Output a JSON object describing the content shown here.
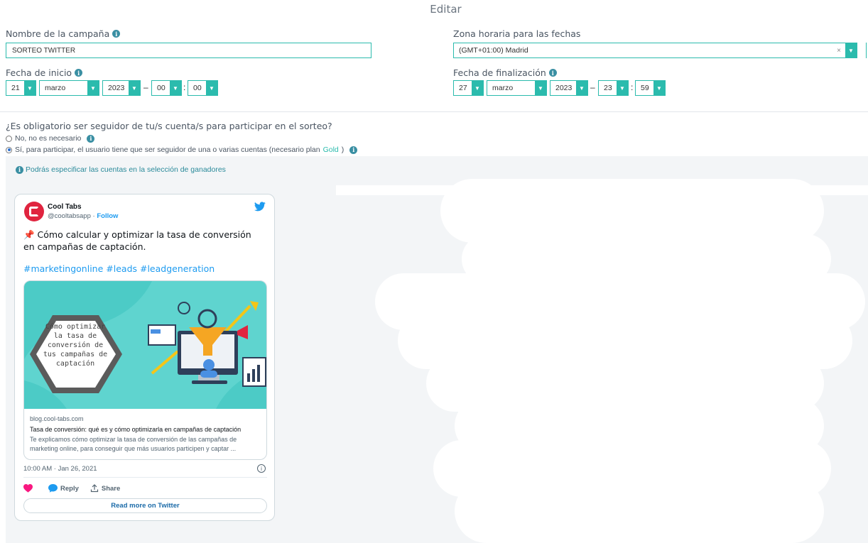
{
  "header": {
    "title": "Editar"
  },
  "campaign": {
    "name_label": "Nombre de la campaña",
    "name_value": "SORTEO TWITTER"
  },
  "timezone": {
    "label": "Zona horaria para las fechas",
    "value": "(GMT+01:00) Madrid",
    "clear": "×"
  },
  "start_date": {
    "label": "Fecha de inicio",
    "day": "21",
    "month": "marzo",
    "year": "2023",
    "hour": "00",
    "minute": "00"
  },
  "end_date": {
    "label": "Fecha de finalización",
    "day": "27",
    "month": "marzo",
    "year": "2023",
    "hour": "23",
    "minute": "59"
  },
  "follower": {
    "question": "¿Es obligatorio ser seguidor de tu/s cuenta/s para participar en el sorteo?",
    "option_no": "No, no es necesario",
    "option_yes_pre": "Sí, para participar, el usuario tiene que ser seguidor de una o varias cuentas (necesario plan",
    "option_yes_plan": "Gold",
    "option_yes_post": ")",
    "selected": "yes",
    "hint": "Podrás especificar las cuentas en la selección de ganadores"
  },
  "tweet": {
    "author_name": "Cool Tabs",
    "handle": "@cooltabsapp",
    "dot": "·",
    "follow": "Follow",
    "text": "📌 Cómo calcular y optimizar la tasa de conversión en campañas de captación.",
    "hashtags": "#marketingonline #leads #leadgeneration",
    "card": {
      "image_text": [
        "Cómo optimizar",
        "la tasa de",
        "conversión de",
        "tus campañas de",
        "captación"
      ],
      "domain": "blog.cool-tabs.com",
      "title": "Tasa de conversión: qué es y cómo optimizarla en campañas de captación",
      "description": "Te explicamos cómo optimizar la tasa de conversión de las campañas de marketing online, para conseguir que más usuarios participen y captar ..."
    },
    "timestamp": "10:00 AM · Jan 26, 2021",
    "reply_label": "Reply",
    "share_label": "Share",
    "read_more": "Read more on Twitter"
  },
  "colors": {
    "accent": "#2bbbad",
    "twitter_blue": "#1d9bf0",
    "heart": "#f91880",
    "brand_red": "#e0243f",
    "card_bg": "#5fd4cf"
  },
  "icons": [
    "info-icon",
    "chevron-down-icon",
    "twitter-bird-icon",
    "heart-icon",
    "reply-bubble-icon",
    "share-icon",
    "info-circle-icon"
  ]
}
